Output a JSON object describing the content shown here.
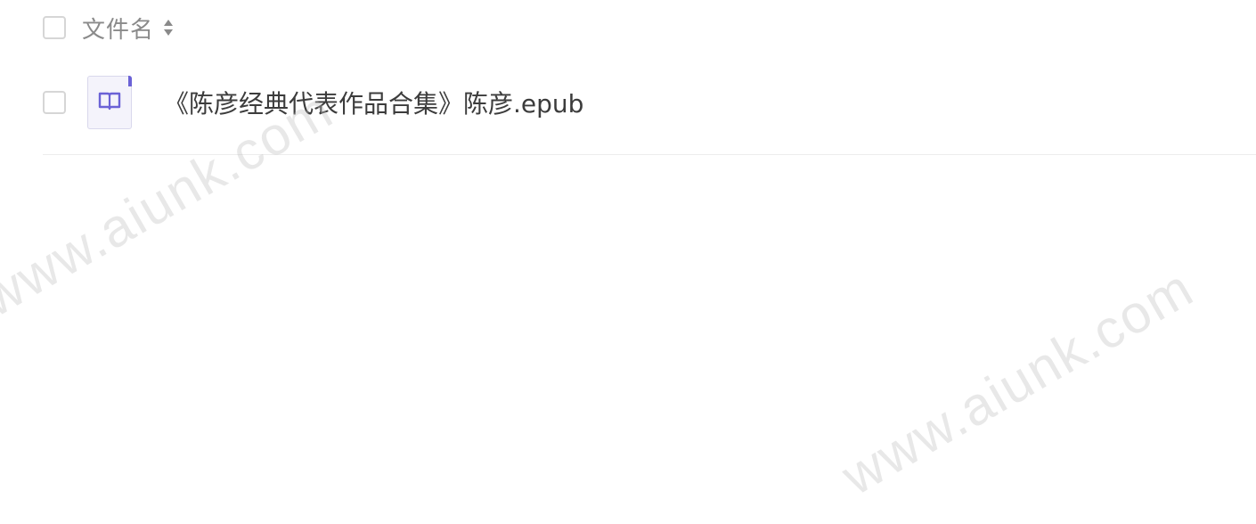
{
  "header": {
    "column_label": "文件名",
    "sort_icon": "sort-updown-icon"
  },
  "files": [
    {
      "name": "《陈彦经典代表作品合集》陈彦.epub",
      "icon": "book-icon"
    }
  ],
  "watermarks": [
    "www.aiunk.com",
    "www.aiunk.com"
  ],
  "colors": {
    "accent": "#6b62d6",
    "thumb_bg": "#f4f3fb",
    "header_text": "#8a8a8a",
    "row_text": "#3c3c3c",
    "divider": "#ececec"
  }
}
